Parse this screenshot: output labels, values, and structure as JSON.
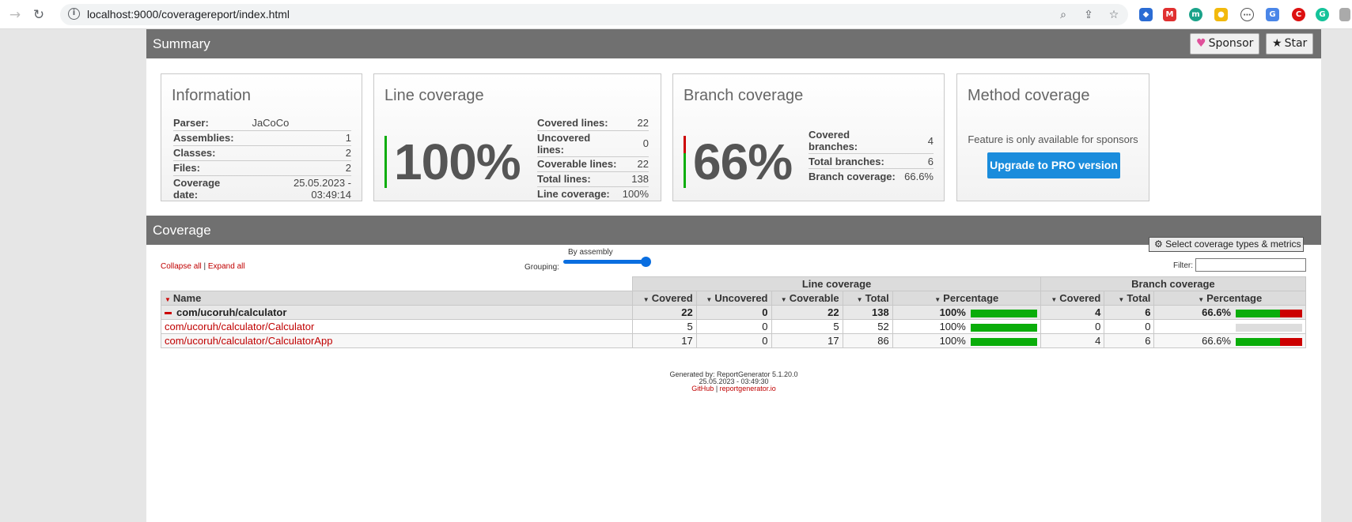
{
  "browser": {
    "url": "localhost:9000/coveragereport/index.html",
    "info_icon": "info-icon"
  },
  "summary": {
    "title": "Summary",
    "sponsor_label": "Sponsor",
    "star_label": "Star"
  },
  "information": {
    "title": "Information",
    "rows": [
      {
        "label": "Parser:",
        "value": "JaCoCo"
      },
      {
        "label": "Assemblies:",
        "value": "1"
      },
      {
        "label": "Classes:",
        "value": "2"
      },
      {
        "label": "Files:",
        "value": "2"
      },
      {
        "label": "Coverage date:",
        "value": "25.05.2023 - 03:49:14"
      }
    ]
  },
  "line_coverage": {
    "title": "Line coverage",
    "percent": "100%",
    "rows": [
      {
        "label": "Covered lines:",
        "value": "22"
      },
      {
        "label": "Uncovered lines:",
        "value": "0"
      },
      {
        "label": "Coverable lines:",
        "value": "22"
      },
      {
        "label": "Total lines:",
        "value": "138"
      },
      {
        "label": "Line coverage:",
        "value": "100%"
      }
    ]
  },
  "branch_coverage": {
    "title": "Branch coverage",
    "percent": "66%",
    "rows": [
      {
        "label": "Covered branches:",
        "value": "4"
      },
      {
        "label": "Total branches:",
        "value": "6"
      },
      {
        "label": "Branch coverage:",
        "value": "66.6%"
      }
    ]
  },
  "method_coverage": {
    "title": "Method coverage",
    "text": "Feature is only available for sponsors",
    "button": "Upgrade to PRO version"
  },
  "coverage": {
    "title": "Coverage",
    "collapse_all": "Collapse all",
    "separator": "|",
    "expand_all": "Expand all",
    "grouping_label": "Grouping:",
    "grouping_value": "By assembly",
    "metrics_button": "Select coverage types & metrics",
    "filter_label": "Filter:",
    "group_headers": {
      "line": "Line coverage",
      "branch": "Branch coverage"
    },
    "columns": {
      "name": "Name",
      "covered": "Covered",
      "uncovered": "Uncovered",
      "coverable": "Coverable",
      "total": "Total",
      "percentage": "Percentage",
      "b_covered": "Covered",
      "b_total": "Total",
      "b_percentage": "Percentage"
    },
    "rows": [
      {
        "name": "com/ucoruh/calculator",
        "covered": "22",
        "uncovered": "0",
        "coverable": "22",
        "total": "138",
        "pct": "100%",
        "line_fraction": 1.0,
        "b_covered": "4",
        "b_total": "6",
        "b_pct": "66.6%",
        "branch_fraction": 0.666
      },
      {
        "name": "com/ucoruh/calculator/Calculator",
        "covered": "5",
        "uncovered": "0",
        "coverable": "5",
        "total": "52",
        "pct": "100%",
        "line_fraction": 1.0,
        "b_covered": "0",
        "b_total": "0",
        "b_pct": "",
        "branch_fraction": null
      },
      {
        "name": "com/ucoruh/calculator/CalculatorApp",
        "covered": "17",
        "uncovered": "0",
        "coverable": "17",
        "total": "86",
        "pct": "100%",
        "line_fraction": 1.0,
        "b_covered": "4",
        "b_total": "6",
        "b_pct": "66.6%",
        "branch_fraction": 0.666
      }
    ]
  },
  "footer": {
    "generated": "Generated by: ReportGenerator 5.1.20.0",
    "date": "25.05.2023 - 03:49:30",
    "github": "GitHub",
    "sep": "|",
    "site": "reportgenerator.io"
  },
  "colors": {
    "covered": "#0aad0a",
    "uncovered": "#cc0000",
    "header": "#707070",
    "link": "#c00000",
    "pro_button": "#1a8cdc"
  }
}
